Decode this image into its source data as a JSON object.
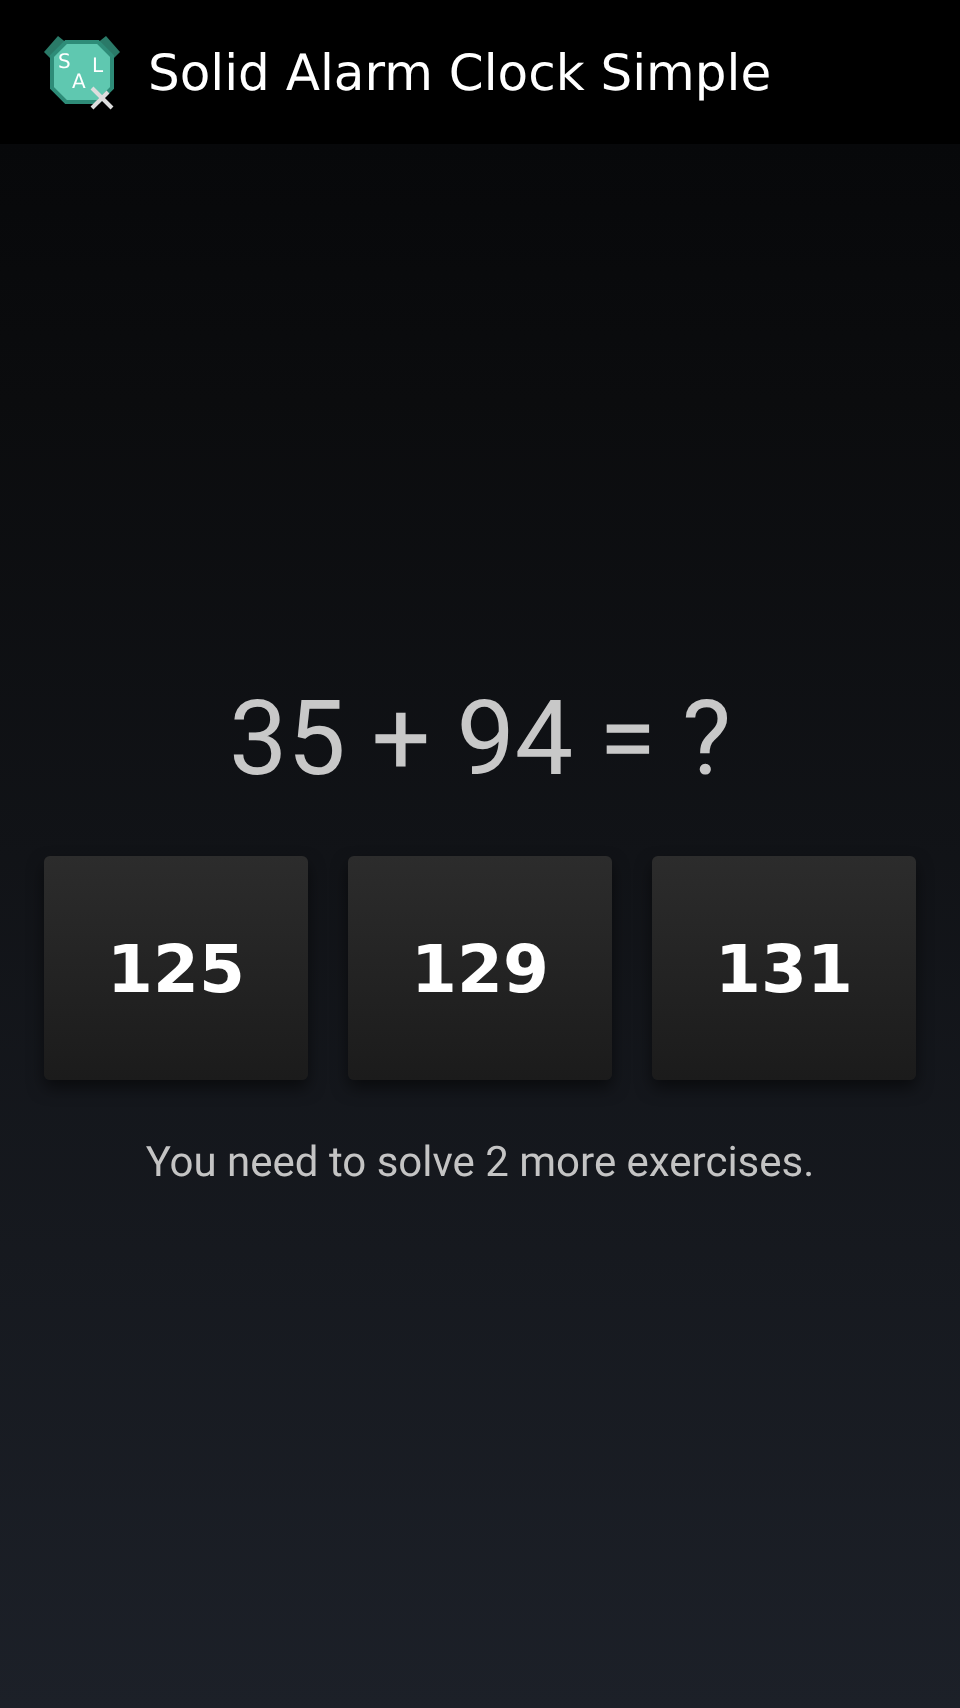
{
  "action_bar": {
    "icon_letters": [
      "S",
      "A",
      "L"
    ],
    "title": "Solid Alarm Clock Simple"
  },
  "exercise": {
    "equation": "35 + 94 = ?",
    "answers": [
      "125",
      "129",
      "131"
    ],
    "remaining": "You need to solve 2 more exercises."
  }
}
